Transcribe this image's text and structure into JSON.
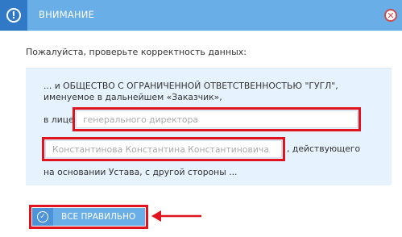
{
  "dialog": {
    "title": "ВНИМАНИЕ",
    "close_symbol": "✕"
  },
  "prompt": "Пожалуйста, проверьте корректность данных:",
  "panel": {
    "line1": "... и ОБЩЕСТВО С ОГРАНИЧЕННОЙ ОТВЕТСТВЕННОСТЬЮ \"ГУГЛ\",",
    "line2": "именуемое в дальнейшем «Заказчик»,",
    "in_person_label": "в лице",
    "position_placeholder": "генерального директора",
    "name_placeholder": "Константинова Константина Константиновича",
    "after_name": ", действующего",
    "line4": "на основании Устава, с другой стороны ..."
  },
  "confirm_button": {
    "label": "ВСЕ ПРАВИЛЬНО"
  },
  "colors": {
    "header": "#6aaee8",
    "header_icon_box": "#2f79c6",
    "panel_bg": "#e6f2fd",
    "highlight": "#e0141e"
  },
  "icons": {
    "title": "warning-icon",
    "close": "close-icon",
    "button": "check-circle-icon",
    "annotation": "arrow-left-icon"
  }
}
